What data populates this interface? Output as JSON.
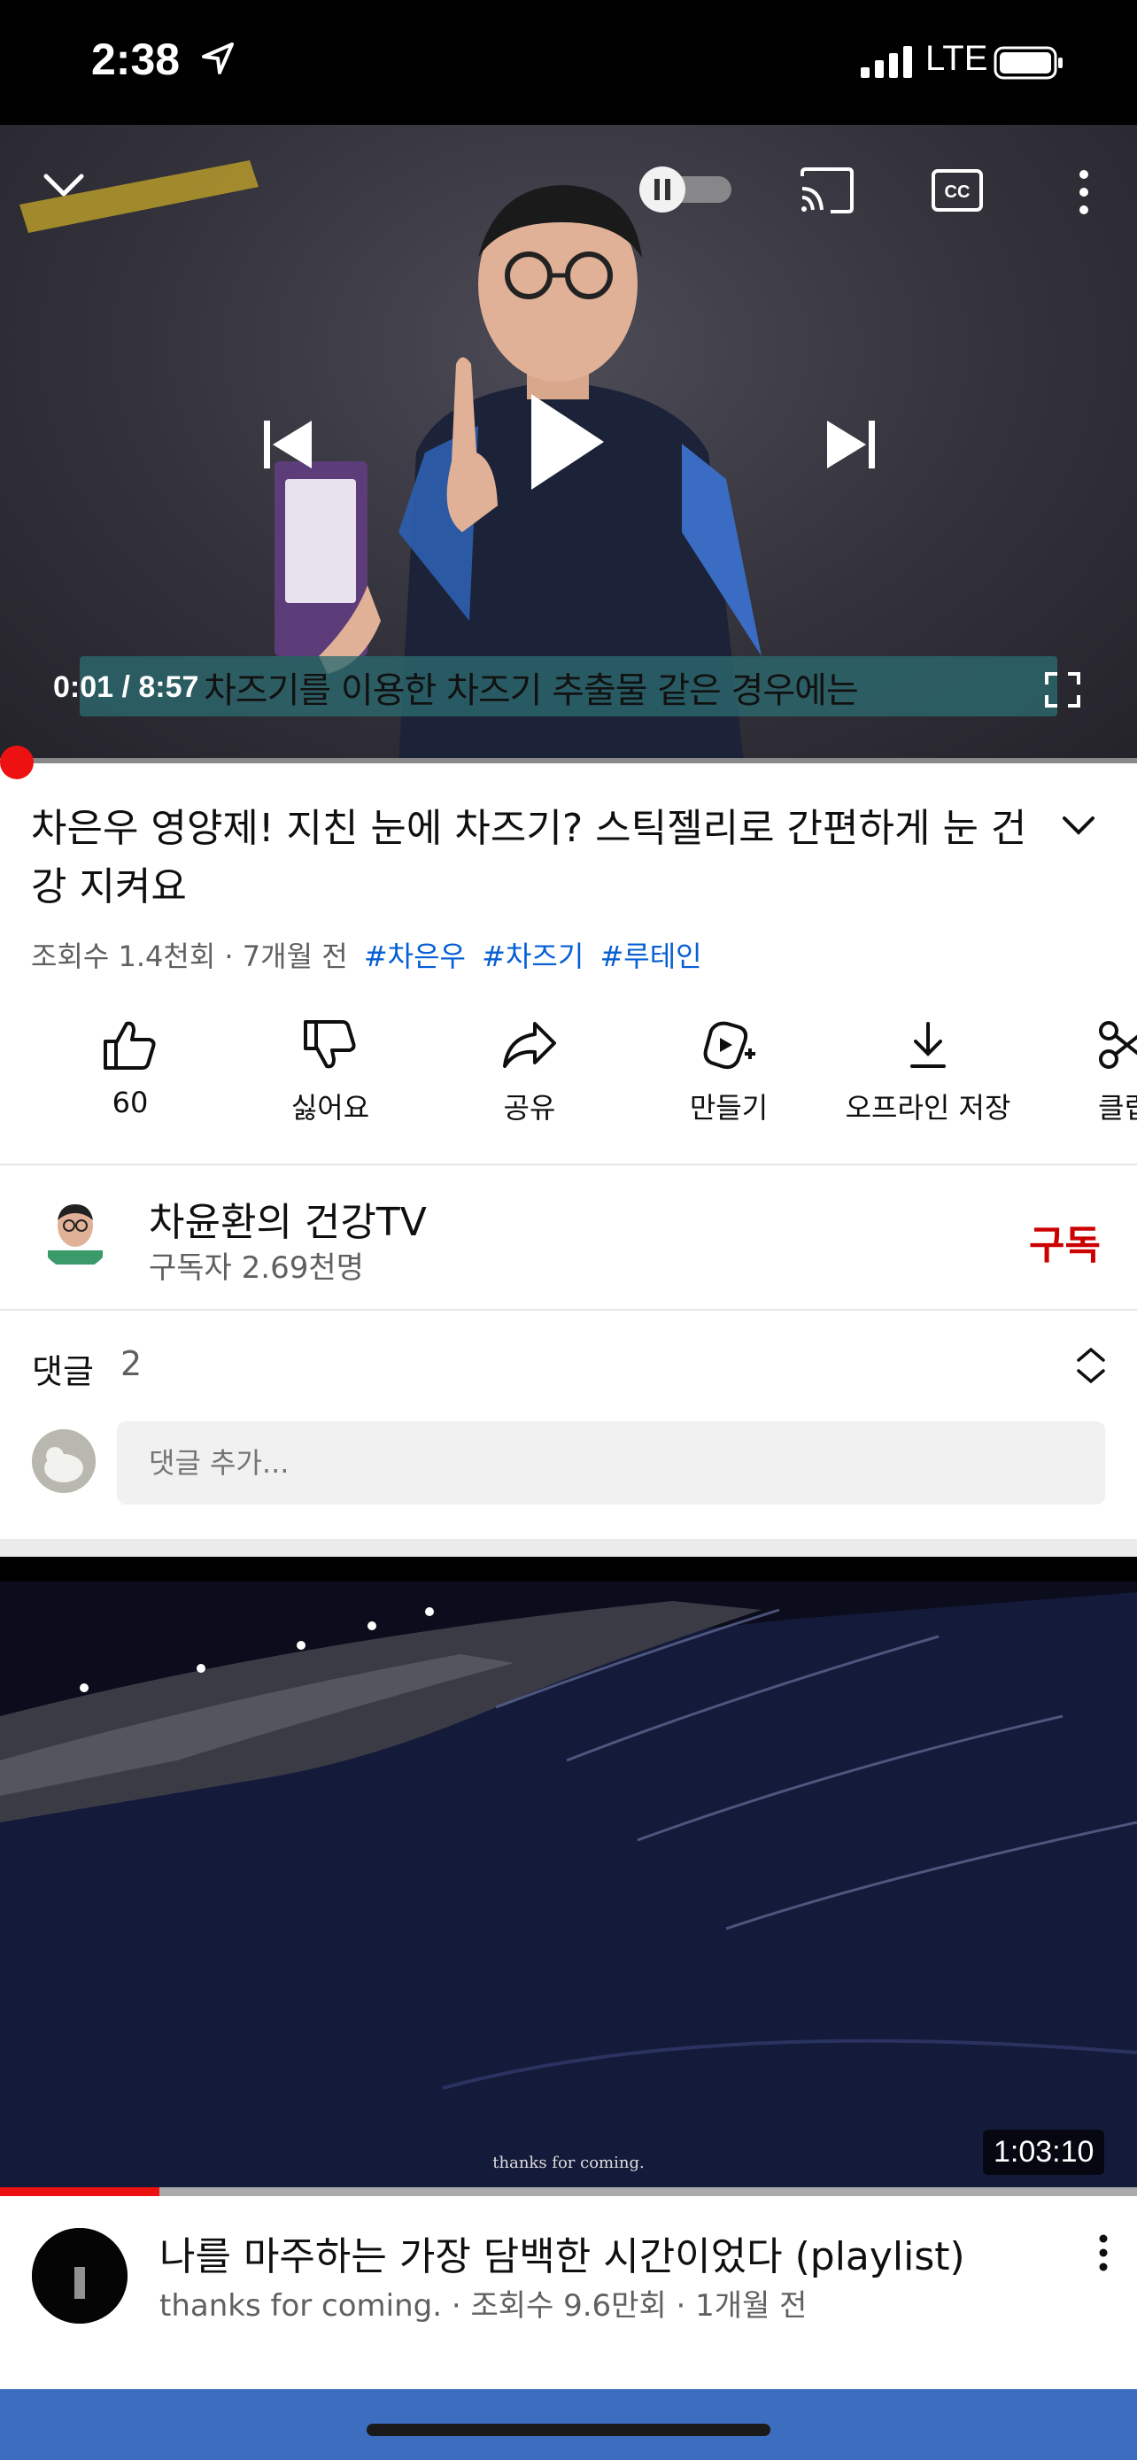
{
  "status": {
    "time": "2:38",
    "network": "LTE"
  },
  "player": {
    "time": "0:01 / 8:57",
    "subtitle": "차즈기를 이용한 차즈기 추출물 같은 경우에는",
    "progress_fraction": 0.002
  },
  "video": {
    "title": "차은우 영양제! 지친 눈에 차즈기? 스틱젤리로 간편하게 눈 건강 지켜요",
    "meta": "조회수 1.4천회 · 7개월 전",
    "tags": [
      "#차은우",
      "#차즈기",
      "#루테인"
    ]
  },
  "actions": [
    {
      "icon": "thumbs-up-icon",
      "label": "60"
    },
    {
      "icon": "thumbs-down-icon",
      "label": "싫어요"
    },
    {
      "icon": "share-icon",
      "label": "공유"
    },
    {
      "icon": "remix-icon",
      "label": "만들기"
    },
    {
      "icon": "download-icon",
      "label": "오프라인 저장"
    },
    {
      "icon": "clip-icon",
      "label": "클립"
    }
  ],
  "channel": {
    "name": "차윤환의 건강TV",
    "subscribers": "구독자 2.69천명",
    "subscribe_label": "구독"
  },
  "comments": {
    "title": "댓글",
    "count": "2",
    "placeholder": "댓글 추가..."
  },
  "next_video": {
    "title": "나를 마주하는 가장 담백한 시간이었다 (playlist)",
    "meta": "thanks for coming. · 조회수 9.6만회 · 1개월 전",
    "duration": "1:03:10",
    "thumb_caption": "thanks for coming.",
    "watched_fraction": 0.14
  },
  "colors": {
    "accent": "#cc0000",
    "link": "#065fd4",
    "progress": "#ee1111"
  }
}
